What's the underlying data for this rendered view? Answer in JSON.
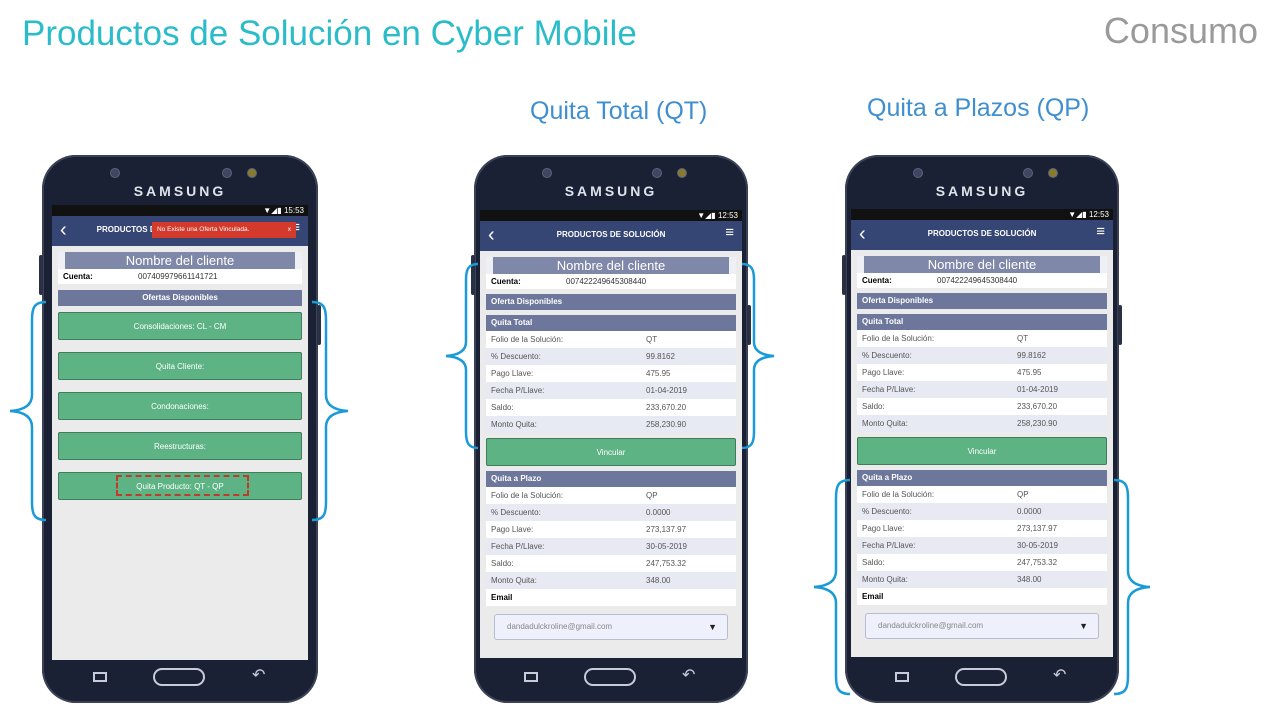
{
  "slide": {
    "title": "Productos de Solución en Cyber Mobile",
    "tag": "Consumo",
    "col_qt": "Quita Total (QT)",
    "col_qp": "Quita a Plazos (QP)"
  },
  "phone1": {
    "brand": "SAMSUNG",
    "status_time": "15:53",
    "app_title": "PRODUCTOS DE SOLUCIÓN",
    "toast": "No Existe una Oferta Vinculada.",
    "toast_close": "x",
    "client_name": "Nombre del cliente",
    "cuenta_label": "Cuenta:",
    "cuenta_value": "007409979661141721",
    "section": "Ofertas Disponibles",
    "offers": [
      "Consolidaciones: CL - CM",
      "Quita Cliente:",
      "Condonaciones:",
      "Reestructuras:",
      "Quita Producto: QT - QP"
    ]
  },
  "phone2": {
    "brand": "SAMSUNG",
    "status_time": "12:53",
    "app_title": "PRODUCTOS DE SOLUCIÓN",
    "client_name": "Nombre del cliente",
    "cuenta_label": "Cuenta:",
    "cuenta_value": "007422249645308440",
    "section": "Oferta Disponibles",
    "qt_title": "Quita Total",
    "qt_rows": [
      {
        "k": "Folio de la Solución:",
        "v": "QT"
      },
      {
        "k": "% Descuento:",
        "v": "99.8162"
      },
      {
        "k": "Pago Llave:",
        "v": "475.95"
      },
      {
        "k": "Fecha P/Llave:",
        "v": "01-04-2019"
      },
      {
        "k": "Saldo:",
        "v": "233,670.20"
      },
      {
        "k": "Monto Quita:",
        "v": "258,230.90"
      }
    ],
    "vincular": "Vincular",
    "qp_title": "Quita a Plazo",
    "qp_rows": [
      {
        "k": "Folio de la Solución:",
        "v": "QP"
      },
      {
        "k": "% Descuento:",
        "v": "0.0000"
      },
      {
        "k": "Pago Llave:",
        "v": "273,137.97"
      },
      {
        "k": "Fecha P/Llave:",
        "v": "30-05-2019"
      },
      {
        "k": "Saldo:",
        "v": "247,753.32"
      },
      {
        "k": "Monto Quita:",
        "v": "348.00"
      }
    ],
    "email_label": "Email",
    "email_value": "dandadulckroline@gmail.com"
  },
  "phone3": {
    "brand": "SAMSUNG",
    "status_time": "12:53",
    "app_title": "PRODUCTOS DE SOLUCIÓN",
    "client_name": "Nombre del cliente",
    "cuenta_label": "Cuenta:",
    "cuenta_value": "007422249645308440",
    "section": "Oferta Disponibles",
    "qt_title": "Quita Total",
    "qt_rows": [
      {
        "k": "Folio de la Solución:",
        "v": "QT"
      },
      {
        "k": "% Descuento:",
        "v": "99.8162"
      },
      {
        "k": "Pago Llave:",
        "v": "475.95"
      },
      {
        "k": "Fecha P/Llave:",
        "v": "01-04-2019"
      },
      {
        "k": "Saldo:",
        "v": "233,670.20"
      },
      {
        "k": "Monto Quita:",
        "v": "258,230.90"
      }
    ],
    "vincular": "Vincular",
    "qp_title": "Quita a Plazo",
    "qp_rows": [
      {
        "k": "Folio de la Solución:",
        "v": "QP"
      },
      {
        "k": "% Descuento:",
        "v": "0.0000"
      },
      {
        "k": "Pago Llave:",
        "v": "273,137.97"
      },
      {
        "k": "Fecha P/Llave:",
        "v": "30-05-2019"
      },
      {
        "k": "Saldo:",
        "v": "247,753.32"
      },
      {
        "k": "Monto Quita:",
        "v": "348.00"
      }
    ],
    "email_label": "Email",
    "email_value": "dandadulckroline@gmail.com"
  },
  "icons": {
    "back": "chevron-left-icon",
    "menu": "hamburger-menu-icon",
    "dropdown": "caret-down-icon",
    "nav_recent": "recent-apps-icon",
    "nav_home": "home-button-icon",
    "nav_back": "back-arrow-icon"
  },
  "colors": {
    "title": "#2bbcc9",
    "subtitle": "#3f8fd0",
    "appbar": "#354574",
    "section": "#6d769b",
    "button": "#5db384",
    "toast": "#d33a2c",
    "brace": "#1a9ad6",
    "highlight": "#c0392b"
  }
}
